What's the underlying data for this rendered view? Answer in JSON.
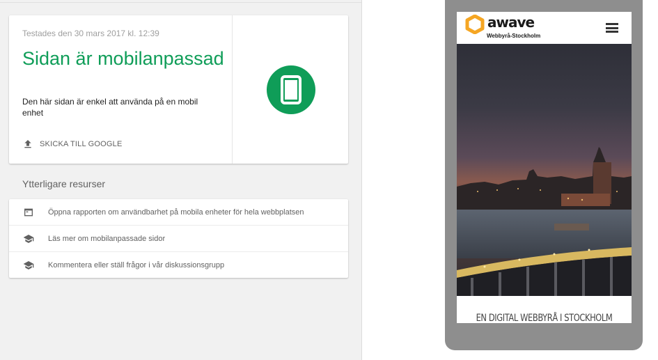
{
  "result": {
    "tested_text": "Testades den 30 mars 2017 kl. 12:39",
    "verdict": "Sidan är mobilanpassad",
    "description": "Den här sidan är enkel att använda på en mobil enhet",
    "submit_label": "SKICKA TILL GOOGLE",
    "verdict_color": "#0f9d58",
    "icon": "smartphone-icon"
  },
  "resources": {
    "heading": "Ytterligare resurser",
    "items": [
      {
        "icon": "report-icon",
        "label": "Öppna rapporten om användbarhet på mobila enheter för hela webbplatsen"
      },
      {
        "icon": "school-icon",
        "label": "Läs mer om mobilanpassade sidor"
      },
      {
        "icon": "school-icon",
        "label": "Kommentera eller ställ frågor i vår diskussionsgrupp"
      }
    ]
  },
  "preview": {
    "logo_text": "awave",
    "logo_subtitle": "Webbyrå-Stockholm",
    "menu_icon": "hamburger-icon",
    "caption": "EN DIGITAL WEBBYRÅ I STOCKHOLM",
    "accent_color": "#f5a623"
  }
}
